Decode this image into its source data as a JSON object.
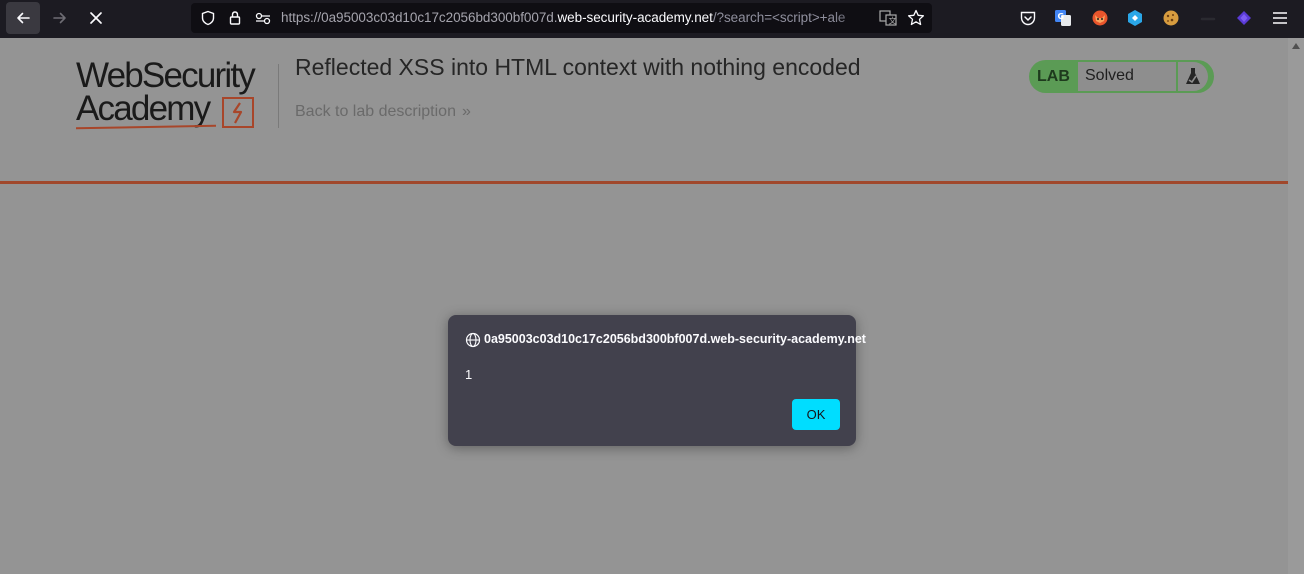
{
  "browser": {
    "url_prefix": "https://0a95003c03d10c17c2056bd300bf007d.",
    "url_host": "web-security-academy.net",
    "url_query": "/?search=<script>+ale",
    "nav": {
      "back_icon": "arrow-left-icon",
      "forward_icon": "arrow-right-icon",
      "stop_icon": "close-icon"
    },
    "extensions": [
      "pocket-icon",
      "translate-icon",
      "fox-icon",
      "hexagon-icon",
      "cookie-icon",
      "dash-icon",
      "diamond-icon",
      "menu-icon"
    ]
  },
  "page": {
    "logo_line1": "WebSecurity",
    "logo_line2": "Academy",
    "title": "Reflected XSS into HTML context with nothing encoded",
    "back_link": "Back to lab description",
    "back_chevron": "»",
    "status": {
      "lab": "LAB",
      "state": "Solved"
    },
    "colors": {
      "accent": "#a0482c",
      "status_green": "#5b9b55",
      "dialog_bg": "#42414d",
      "ok_button": "#00ddff"
    }
  },
  "dialog": {
    "origin": "0a95003c03d10c17c2056bd300bf007d.web-security-academy.net",
    "message": "1",
    "ok_label": "OK"
  }
}
